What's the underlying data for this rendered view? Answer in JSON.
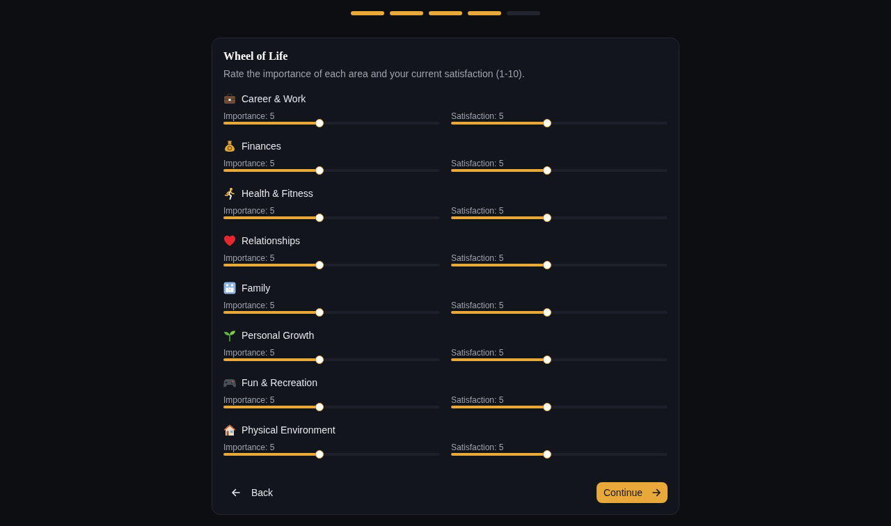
{
  "progress": [
    {
      "completed": true
    },
    {
      "completed": true
    },
    {
      "completed": true
    },
    {
      "completed": true
    },
    {
      "completed": false
    }
  ],
  "title": "Wheel of Life",
  "subtitle": "Rate the importance of each area and your current satisfaction (1-10).",
  "areas": [
    {
      "name": "Career & Work",
      "sliders": [
        {
          "label": "Importance: 5",
          "level": 0.444
        },
        {
          "label": "Satisfaction: 5",
          "level": 0.444
        }
      ]
    },
    {
      "name": "Finances",
      "sliders": [
        {
          "label": "Importance: 5",
          "level": 0.444
        },
        {
          "label": "Satisfaction: 5",
          "level": 0.444
        }
      ]
    },
    {
      "name": "Health & Fitness",
      "sliders": [
        {
          "label": "Importance: 5",
          "level": 0.444
        },
        {
          "label": "Satisfaction: 5",
          "level": 0.444
        }
      ]
    },
    {
      "name": "Relationships",
      "sliders": [
        {
          "label": "Importance: 5",
          "level": 0.444
        },
        {
          "label": "Satisfaction: 5",
          "level": 0.444
        }
      ]
    },
    {
      "name": "Family",
      "sliders": [
        {
          "label": "Importance: 5",
          "level": 0.444
        },
        {
          "label": "Satisfaction: 5",
          "level": 0.444
        }
      ]
    },
    {
      "name": "Personal Growth",
      "sliders": [
        {
          "label": "Importance: 5",
          "level": 0.444
        },
        {
          "label": "Satisfaction: 5",
          "level": 0.444
        }
      ]
    },
    {
      "name": "Fun & Recreation",
      "sliders": [
        {
          "label": "Importance: 5",
          "level": 0.444
        },
        {
          "label": "Satisfaction: 5",
          "level": 0.444
        }
      ]
    },
    {
      "name": "Physical Environment",
      "sliders": [
        {
          "label": "Importance: 5",
          "level": 0.444
        },
        {
          "label": "Satisfaction: 5",
          "level": 0.444
        }
      ]
    }
  ],
  "back_button": {
    "label": "Back"
  },
  "continue_button": {
    "label": "Continue"
  }
}
